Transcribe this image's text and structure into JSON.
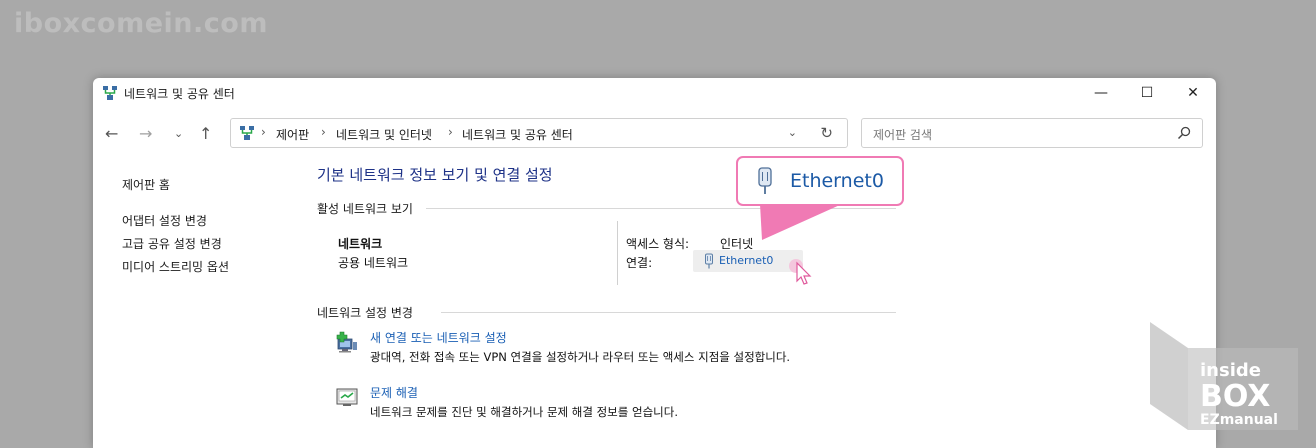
{
  "watermark": {
    "text": "iboxcomein.com"
  },
  "window": {
    "title": "네트워크 및 공유 센터",
    "controls": {
      "minimize": "—",
      "maximize": "☐",
      "close": "✕"
    }
  },
  "nav": {
    "back": "←",
    "forward": "→",
    "recent": "⌄",
    "up": "↑"
  },
  "address": {
    "crumbs": [
      "제어판",
      "네트워크 및 인터넷",
      "네트워크 및 공유 센터"
    ],
    "separator": "›",
    "dropdown": "⌄",
    "refresh": "↻"
  },
  "search": {
    "placeholder": "제어판 검색",
    "icon": "search-icon"
  },
  "sidebar": {
    "home": "제어판 홈",
    "items": [
      "어댑터 설정 변경",
      "고급 공유 설정 변경",
      "미디어 스트리밍 옵션"
    ]
  },
  "main": {
    "title": "기본 네트워크 정보 보기 및 연결 설정",
    "active_section": "활성 네트워크 보기",
    "network": {
      "name": "네트워크",
      "type": "공용 네트워크"
    },
    "access_label": "액세스 형식:",
    "access_value": "인터넷",
    "connection_label": "연결:",
    "connection_value": "Ethernet0",
    "change_section": "네트워크 설정 변경",
    "tasks": [
      {
        "link": "새 연결 또는 네트워크 설정",
        "desc": "광대역, 전화 접속 또는 VPN 연결을 설정하거나 라우터 또는 액세스 지점을 설정합니다.",
        "icon": "new-connection-icon"
      },
      {
        "link": "문제 해결",
        "desc": "네트워크 문제를 진단 및 해결하거나 문제 해결 정보를 얻습니다.",
        "icon": "troubleshoot-icon"
      }
    ]
  },
  "callout": {
    "text": "Ethernet0"
  },
  "badge": {
    "line1": "inside",
    "line2": "BOX",
    "line3": "EZmanual"
  },
  "colors": {
    "link": "#1a5fb4",
    "title": "#1e3287",
    "callout_border": "#f07ab4"
  }
}
